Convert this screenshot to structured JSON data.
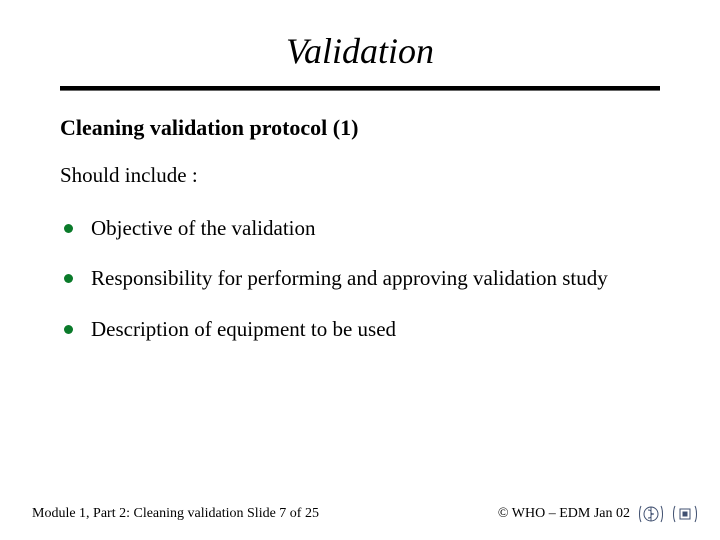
{
  "title": "Validation",
  "subtitle": "Cleaning validation protocol  (1)",
  "lead": "Should include :",
  "bullets": [
    "Objective of the validation",
    "Responsibility for performing and approving validation study",
    "Description of equipment to be used"
  ],
  "footer": {
    "left": "Module 1, Part 2: Cleaning validation  Slide 7 of 25",
    "right": "© WHO – EDM Jan 02"
  },
  "colors": {
    "bullet": "#0a7a2a"
  }
}
